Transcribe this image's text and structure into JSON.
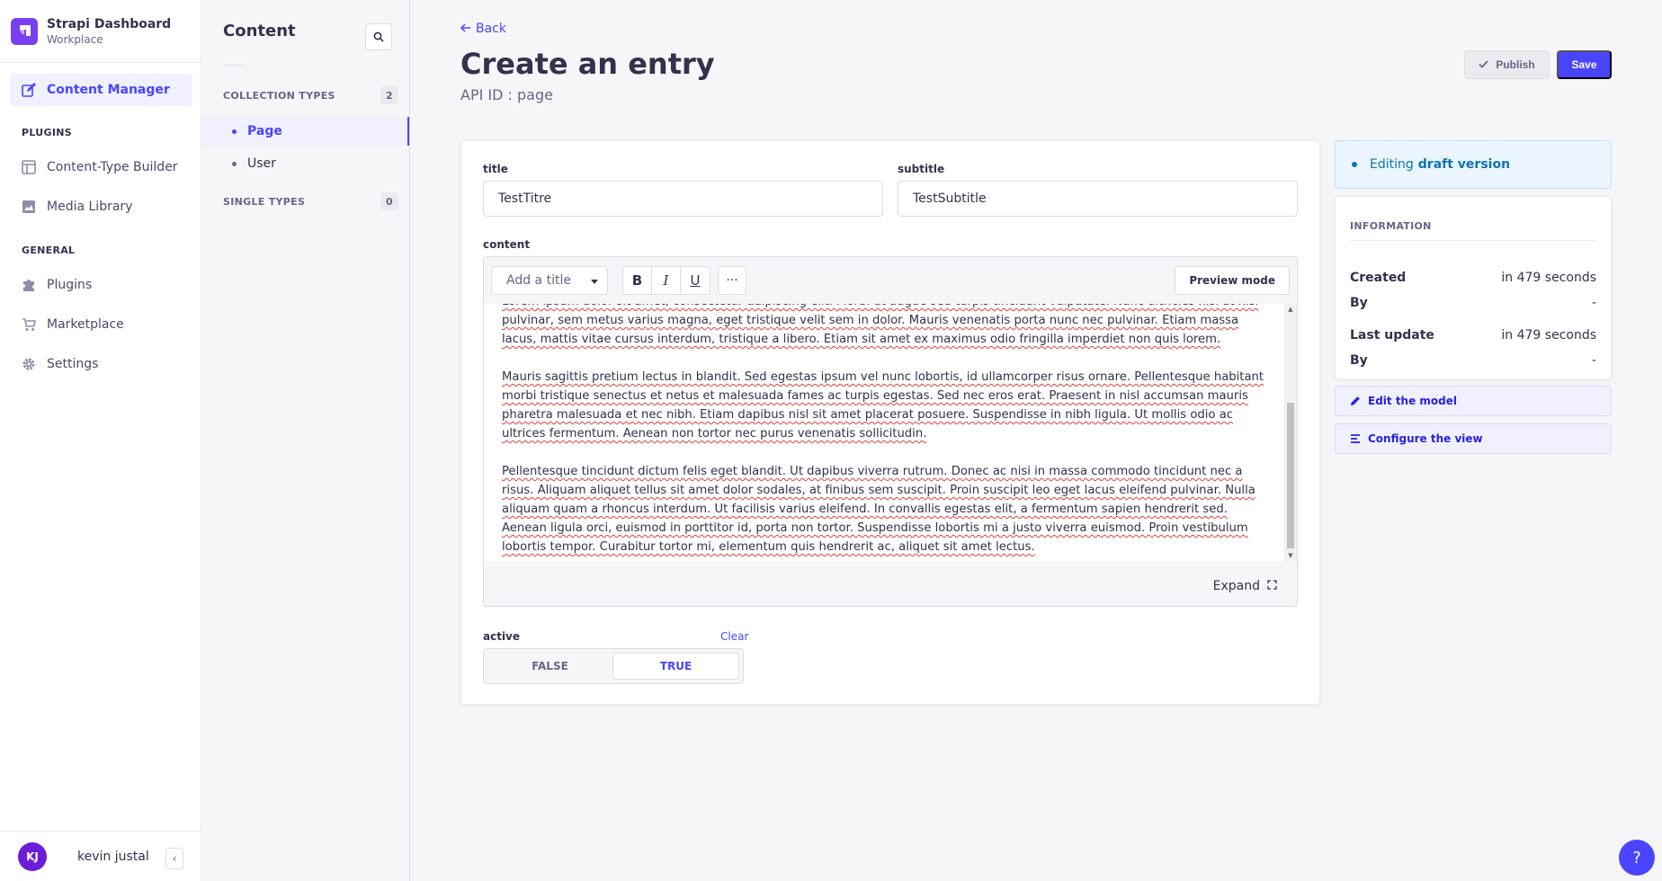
{
  "brand": {
    "title": "Strapi Dashboard",
    "subtitle": "Workplace",
    "color": "#7b3ff2"
  },
  "mainnav": {
    "content_manager": "Content Manager",
    "plugins_section": "PLUGINS",
    "content_type_builder": "Content-Type Builder",
    "media_library": "Media Library",
    "general_section": "GENERAL",
    "plugins": "Plugins",
    "marketplace": "Marketplace",
    "settings": "Settings"
  },
  "user": {
    "initials": "KJ",
    "name": "kevin justal"
  },
  "subnav": {
    "title": "Content",
    "collection_types": "COLLECTION TYPES",
    "collection_count": "2",
    "items": [
      "Page",
      "User"
    ],
    "single_types": "SINGLE TYPES",
    "single_count": "0"
  },
  "header": {
    "back": "Back",
    "title": "Create an entry",
    "api_id": "API ID : page",
    "publish": "Publish",
    "save": "Save"
  },
  "form": {
    "title_label": "title",
    "title_value": "TestTitre",
    "subtitle_label": "subtitle",
    "subtitle_value": "TestSubtitle",
    "content_label": "content",
    "add_title_placeholder": "Add a title",
    "bold": "B",
    "italic": "I",
    "underline": "U",
    "more": "···",
    "preview_mode": "Preview mode",
    "expand": "Expand",
    "content_paragraphs": [
      "Lorem ipsum dolor sit amet, consectetur adipiscing elit. Morbi ut augue sed turpis tincidunt vulputate. Nunc ultricies nisi at nisi pulvinar, sem metus varius magna, eget tristique velit sem in dolor. Mauris venenatis porta nunc nec pulvinar. Etiam massa lacus, mattis vitae cursus interdum, tristique a libero. Etiam sit amet ex maximus odio fringilla imperdiet non quis lorem.",
      "Mauris sagittis pretium lectus in blandit. Sed egestas ipsum vel nunc lobortis, id ullamcorper risus ornare. Pellentesque habitant morbi tristique senectus et netus et malesuada fames ac turpis egestas. Sed nec eros erat. Praesent in nisl accumsan mauris pharetra malesuada et nec nibh. Etiam dapibus nisl sit amet placerat posuere. Suspendisse in nibh ligula. Ut mollis odio ac ultrices fermentum. Aenean non tortor nec purus venenatis sollicitudin.",
      "Pellentesque tincidunt dictum felis eget blandit. Ut dapibus viverra rutrum. Donec ac nisi in massa commodo tincidunt nec a risus. Aliquam aliquet tellus sit amet dolor sodales, at finibus sem suscipit. Proin suscipit leo eget lacus eleifend pulvinar. Nulla aliquam quam a rhoncus interdum. Ut facilisis varius eleifend. In convallis egestas elit, a fermentum sapien hendrerit sed. Aenean ligula orci, euismod in porttitor id, porta non tortor. Suspendisse lobortis mi a justo viverra euismod. Proin vestibulum lobortis tempor. Curabitur tortor mi, elementum quis hendrerit ac, aliquet sit amet lectus."
    ],
    "active_label": "active",
    "clear": "Clear",
    "false_option": "FALSE",
    "true_option": "TRUE",
    "active_value": true
  },
  "sidebar_panel": {
    "editing_prefix": "Editing",
    "editing_version": "draft version",
    "information_title": "INFORMATION",
    "created_label": "Created",
    "created_value": "in 479 seconds",
    "created_by_label": "By",
    "created_by_value": "-",
    "updated_label": "Last update",
    "updated_value": "in 479 seconds",
    "updated_by_label": "By",
    "updated_by_value": "-",
    "edit_model": "Edit the model",
    "configure_view": "Configure the view"
  },
  "help": "?",
  "colors": {
    "primary": "#4945ff",
    "primary_light": "#f0f0ff",
    "info_bg": "#eaf5ff",
    "info_text": "#0c75af"
  }
}
